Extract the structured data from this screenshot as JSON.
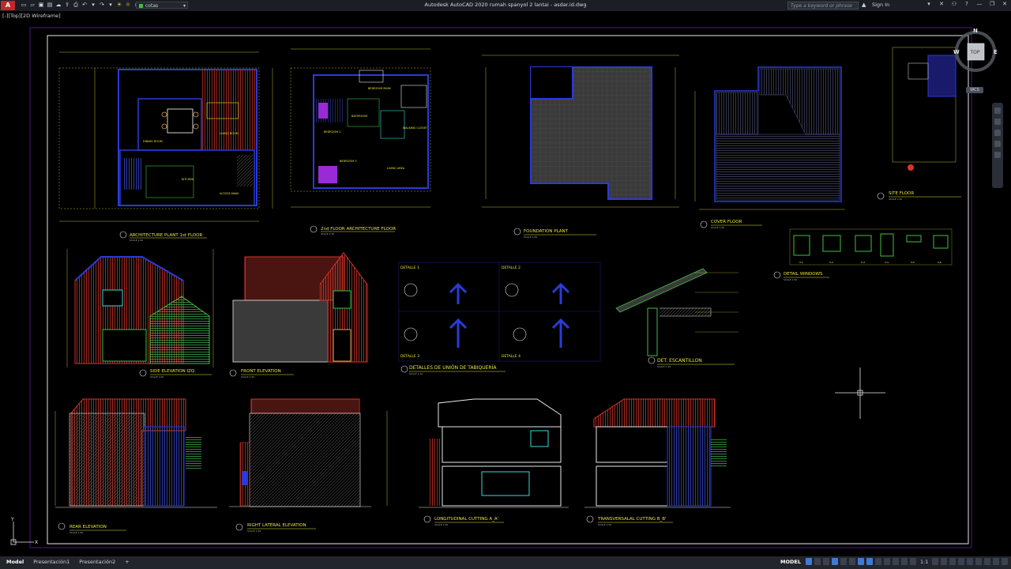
{
  "app": {
    "name": "Autodesk AutoCAD 2020",
    "document": "rumah spanyol 2 lantai - asdar.id.dwg",
    "title_full": "Autodesk AutoCAD 2020   rumah spanyol 2 lantai - asdar.id.dwg",
    "logo_letter": "A",
    "layer_current": "cotas",
    "search_placeholder": "Type a keyword or phrase",
    "sign_in": "Sign In",
    "help": "?"
  },
  "viewport": {
    "label": "[-][Top][2D Wireframe]"
  },
  "viewcube": {
    "n": "N",
    "s": "S",
    "e": "E",
    "w": "W",
    "face": "TOP",
    "wcs": "WCS"
  },
  "ucs": {
    "y": "Y",
    "x": "X"
  },
  "status": {
    "tabs": [
      "Model",
      "Presentación1",
      "Presentación2"
    ],
    "add_tab": "+",
    "model_button": "MODEL",
    "scale": "1:1"
  },
  "drawing": {
    "plans": [
      {
        "title": "ARCHITECTURE PLANT 1st FLOOR",
        "sub": "SCALE 1:50"
      },
      {
        "title": "2nd FLOOR ARCHITECTURE FLOOR",
        "sub": "SCALE 1:50"
      },
      {
        "title": "FOUNDATION PLANT",
        "sub": "SCALE 1:50"
      },
      {
        "title": "COVER FLOOR",
        "sub": "SCALE 1:50"
      },
      {
        "title": "SITE FLOOR",
        "sub": "SCALE 1:50"
      }
    ],
    "rooms": {
      "dining": "DINING ROOM",
      "living": "LIVING ROOM",
      "kitchen": "KITCHEN",
      "access": "ACCESS MAIN",
      "bedroom_main": "BEDROOM MAIN",
      "bathroom": "BATHROOM",
      "bedroom2": "BEDROOM 2",
      "bedroom3": "BEDROOM 3",
      "walking_closet": "WALKING CLOSET",
      "living_area": "LIVING AREA"
    },
    "row2": [
      {
        "title": "SIDE ELEVATION IZQ.",
        "sub": "SCALE 1:50"
      },
      {
        "title": "FRONT ELEVATION",
        "sub": "SCALE 1:50"
      },
      {
        "title": "DETALLES DE UNIÓN DE TABIQUERÍA",
        "sub": "SCALE 1:10"
      },
      {
        "title": "DET. ESCANTILLON",
        "sub": "SCALE 1:20"
      },
      {
        "title": "DETAIL WINDOWS",
        "sub": "SCALE 1:50"
      }
    ],
    "detalles": [
      "DETALLE 1",
      "DETALLE 2",
      "DETALLE 3",
      "DETALLE 4"
    ],
    "row3": [
      {
        "title": "REAR ELEVATION",
        "sub": "SCALE 1:50"
      },
      {
        "title": "RIGHT LATERAL ELEVATION",
        "sub": "SCALE 1:50"
      },
      {
        "title": "LONGITUDINAL CUTTING A_A'",
        "sub": "SCALE 1:50"
      },
      {
        "title": "TRANSVERSALAL CUTTING B_B'",
        "sub": "SCALE 1:50"
      }
    ],
    "window_tags": [
      "V-1",
      "V-2",
      "V-3",
      "V-4",
      "V-5",
      "V-6"
    ]
  },
  "colors": {
    "wall_yellow": "#e8e83a",
    "blue": "#2a3bd8",
    "red": "#d8342a",
    "green": "#3fbf3f",
    "magenta": "#c03ad8",
    "cyan": "#3ad8d8",
    "white": "#ffffff"
  }
}
